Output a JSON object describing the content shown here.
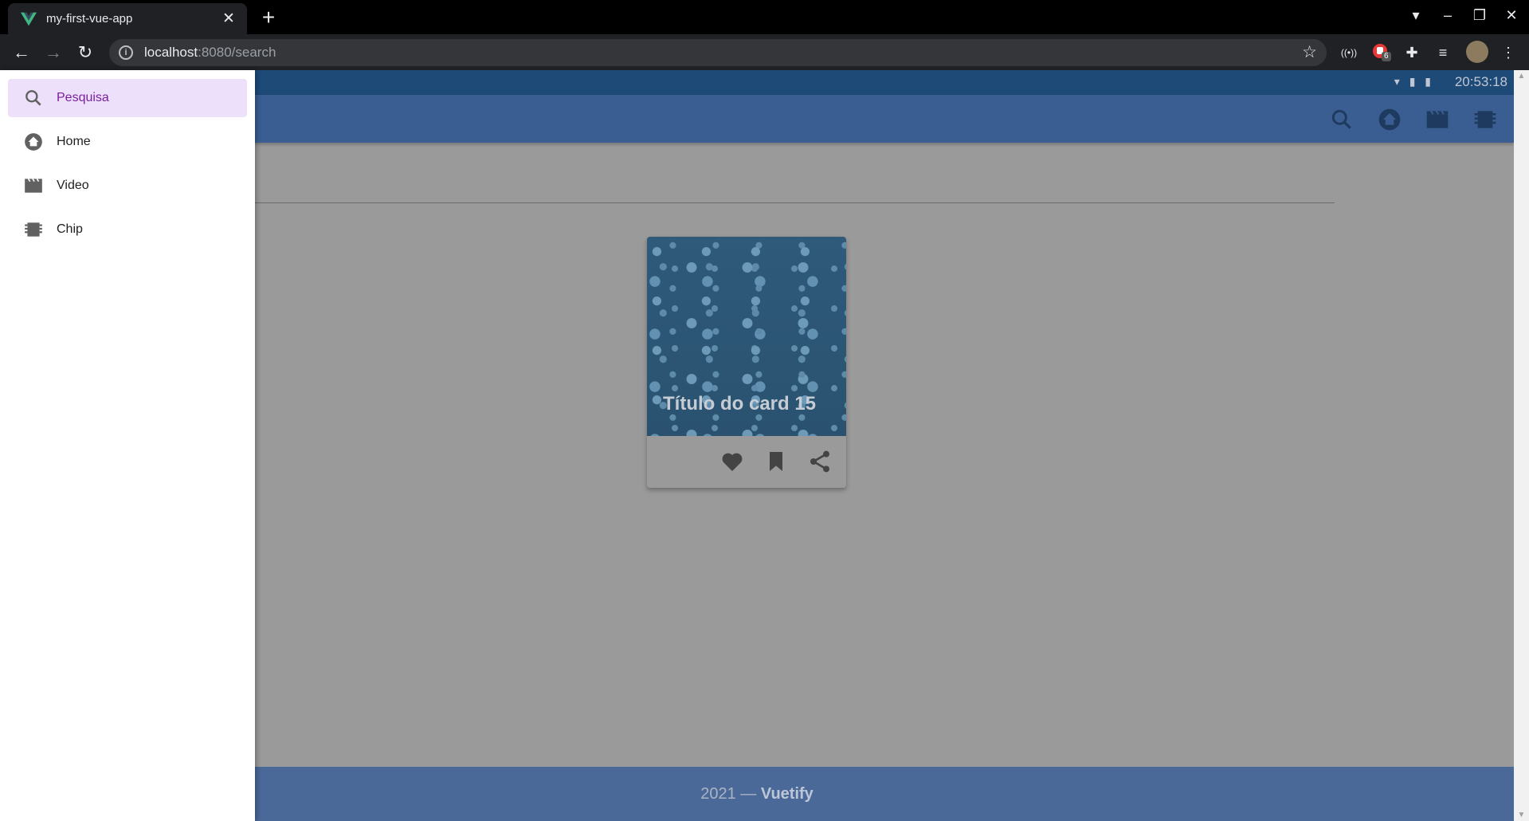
{
  "browser": {
    "tab_title": "my-first-vue-app",
    "url_host": "localhost",
    "url_path": ":8080/search",
    "extension_badge": "6"
  },
  "status": {
    "time": "20:53:18"
  },
  "drawer": {
    "items": [
      {
        "label": "Pesquisa",
        "icon": "search-icon",
        "active": true
      },
      {
        "label": "Home",
        "icon": "home-icon",
        "active": false
      },
      {
        "label": "Video",
        "icon": "video-icon",
        "active": false
      },
      {
        "label": "Chip",
        "icon": "chip-icon",
        "active": false
      }
    ]
  },
  "card": {
    "title": "Título do card 15"
  },
  "footer": {
    "year": "2021 —",
    "brand": "Vuetify"
  },
  "colors": {
    "app_bar": "#3a5e92",
    "footer": "#4a6998",
    "active_nav": "#ede0fb",
    "accent": "#7b1fa2"
  }
}
